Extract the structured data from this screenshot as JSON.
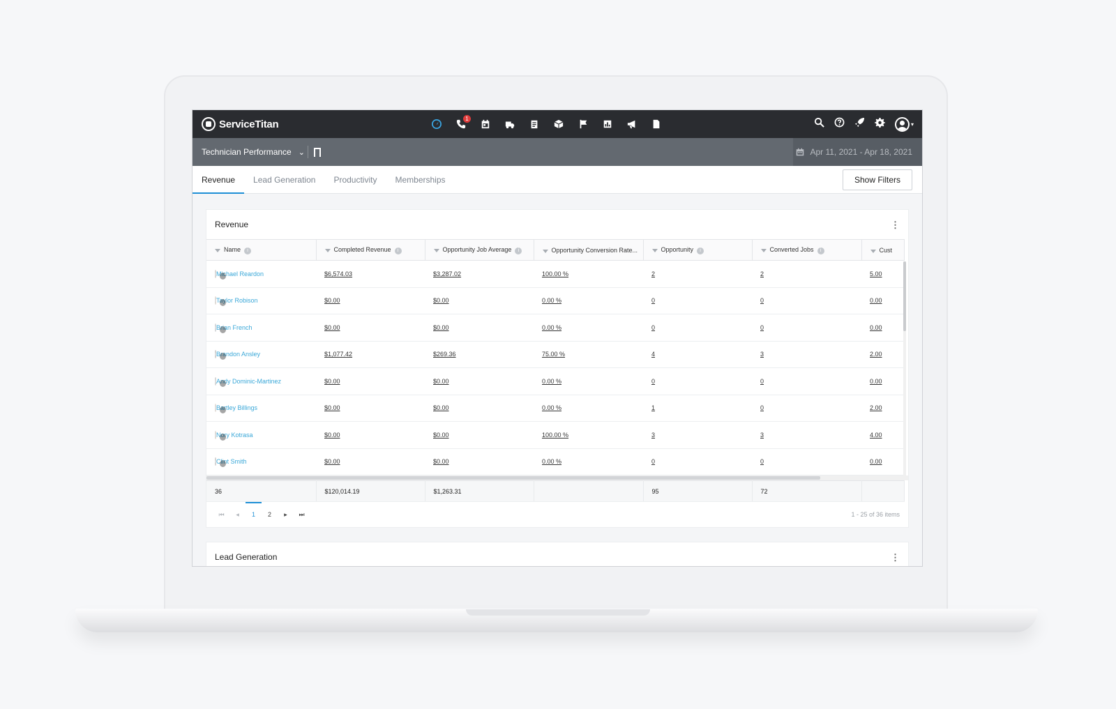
{
  "app": {
    "brand": "ServiceTitan",
    "nav_icons": [
      "dashboard-icon",
      "phone-icon",
      "calendar-icon",
      "truck-icon",
      "clipboard-icon",
      "box-icon",
      "flag-icon",
      "reports-icon",
      "megaphone-icon",
      "document-icon"
    ],
    "phone_badge": "1",
    "right_icons": [
      "search-icon",
      "help-icon",
      "rocket-icon",
      "gear-icon",
      "user-avatar-icon"
    ]
  },
  "subheader": {
    "report_name": "Technician Performance",
    "date_range": "Apr 11, 2021 - Apr 18, 2021"
  },
  "tabs": [
    {
      "label": "Revenue",
      "active": true
    },
    {
      "label": "Lead Generation",
      "active": false
    },
    {
      "label": "Productivity",
      "active": false
    },
    {
      "label": "Memberships",
      "active": false
    }
  ],
  "show_filters_label": "Show Filters",
  "revenue_card": {
    "title": "Revenue",
    "columns": [
      "Name",
      "Completed Revenue",
      "Opportunity Job Average",
      "Opportunity Conversion Rate...",
      "Opportunity",
      "Converted Jobs",
      "Cust"
    ],
    "rows": [
      {
        "name": "Michael Reardon",
        "completed_revenue": "$6,574.03",
        "job_avg": "$3,287.02",
        "conv_rate": "100.00 %",
        "opportunity": "2",
        "converted": "2",
        "cust": "5.00",
        "avatar_color": "#8a6a55"
      },
      {
        "name": "Taylor Robison",
        "completed_revenue": "$0.00",
        "job_avg": "$0.00",
        "conv_rate": "0.00 %",
        "opportunity": "0",
        "converted": "0",
        "cust": "0.00",
        "avatar_color": "#c8935f"
      },
      {
        "name": "Brian French",
        "completed_revenue": "$0.00",
        "job_avg": "$0.00",
        "conv_rate": "0.00 %",
        "opportunity": "0",
        "converted": "0",
        "cust": "0.00",
        "avatar_color": "#5d7386"
      },
      {
        "name": "Brandon Ansley",
        "completed_revenue": "$1,077.42",
        "job_avg": "$269.36",
        "conv_rate": "75.00 %",
        "opportunity": "4",
        "converted": "3",
        "cust": "2.00",
        "avatar_color": "#4a3a32"
      },
      {
        "name": "Andy Dominic-Martinez",
        "completed_revenue": "$0.00",
        "job_avg": "$0.00",
        "conv_rate": "0.00 %",
        "opportunity": "0",
        "converted": "0",
        "cust": "0.00",
        "avatar_color": "#6b6b6b"
      },
      {
        "name": "Bartley Billings",
        "completed_revenue": "$0.00",
        "job_avg": "$0.00",
        "conv_rate": "0.00 %",
        "opportunity": "1",
        "converted": "0",
        "cust": "2.00",
        "avatar_color": "#d9a27a"
      },
      {
        "name": "Nory Kotrasa",
        "completed_revenue": "$0.00",
        "job_avg": "$0.00",
        "conv_rate": "100.00 %",
        "opportunity": "3",
        "converted": "3",
        "cust": "4.00",
        "avatar_color": "#c49a6c"
      },
      {
        "name": "Clint Smith",
        "completed_revenue": "$0.00",
        "job_avg": "$0.00",
        "conv_rate": "0.00 %",
        "opportunity": "0",
        "converted": "0",
        "cust": "0.00",
        "avatar_color": "#5a4a42"
      }
    ],
    "totals": {
      "name": "36",
      "completed_revenue": "$120,014.19",
      "job_avg": "$1,263.31",
      "conv_rate": "",
      "opportunity": "95",
      "converted": "72",
      "cust": ""
    },
    "pager": {
      "pages": [
        "1",
        "2"
      ],
      "current": "1",
      "info": "1 - 25 of 36 items"
    }
  },
  "lead_card": {
    "title": "Lead Generation"
  }
}
